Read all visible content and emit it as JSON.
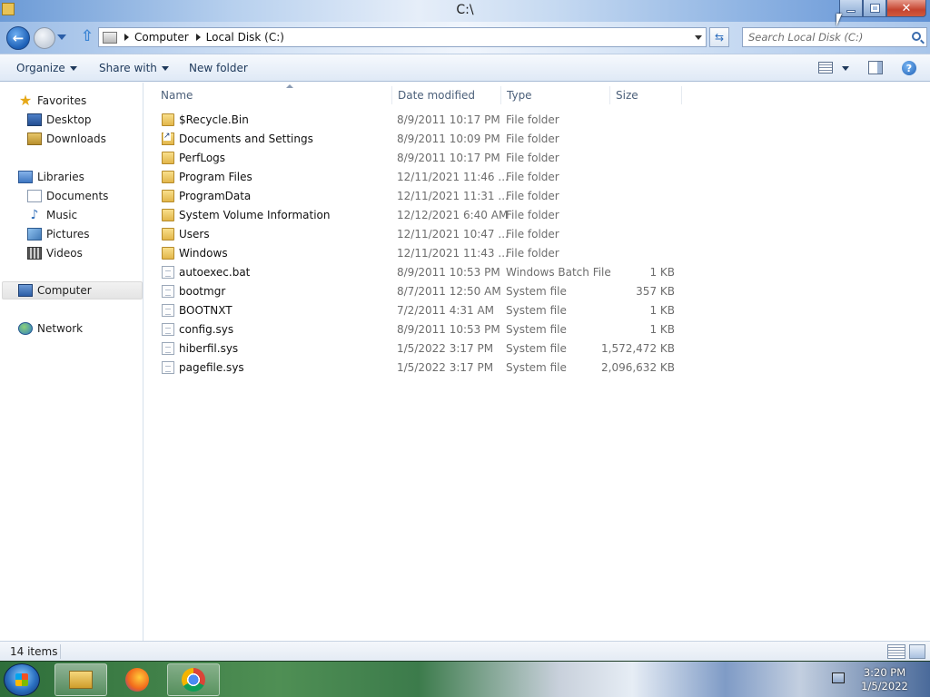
{
  "window": {
    "title": "C:\\",
    "min_label": "",
    "max_label": "",
    "close_label": "✕"
  },
  "address": {
    "crumbs": [
      "Computer",
      "Local Disk (C:)"
    ],
    "search_placeholder": "Search Local Disk (C:)"
  },
  "toolbar": {
    "organize": "Organize",
    "share_with": "Share with",
    "new_folder": "New folder",
    "help": "?"
  },
  "nav": {
    "favorites": "Favorites",
    "desktop": "Desktop",
    "downloads": "Downloads",
    "libraries": "Libraries",
    "documents": "Documents",
    "music": "Music",
    "pictures": "Pictures",
    "videos": "Videos",
    "computer": "Computer",
    "network": "Network"
  },
  "columns": {
    "name": "Name",
    "date": "Date modified",
    "type": "Type",
    "size": "Size"
  },
  "files": [
    {
      "icon": "folder-icon",
      "name": "$Recycle.Bin",
      "date": "8/9/2011 10:17 PM",
      "type": "File folder",
      "size": ""
    },
    {
      "icon": "shortcut-folder-icon",
      "name": "Documents and Settings",
      "date": "8/9/2011 10:09 PM",
      "type": "File folder",
      "size": ""
    },
    {
      "icon": "folder-icon",
      "name": "PerfLogs",
      "date": "8/9/2011 10:17 PM",
      "type": "File folder",
      "size": ""
    },
    {
      "icon": "folder-icon",
      "name": "Program Files",
      "date": "12/11/2021 11:46 ...",
      "type": "File folder",
      "size": ""
    },
    {
      "icon": "folder-icon",
      "name": "ProgramData",
      "date": "12/11/2021 11:31 ...",
      "type": "File folder",
      "size": ""
    },
    {
      "icon": "folder-icon",
      "name": "System Volume Information",
      "date": "12/12/2021 6:40 AM",
      "type": "File folder",
      "size": ""
    },
    {
      "icon": "folder-icon",
      "name": "Users",
      "date": "12/11/2021 10:47 ...",
      "type": "File folder",
      "size": ""
    },
    {
      "icon": "folder-icon",
      "name": "Windows",
      "date": "12/11/2021 11:43 ...",
      "type": "File folder",
      "size": ""
    },
    {
      "icon": "file-icon",
      "name": "autoexec.bat",
      "date": "8/9/2011 10:53 PM",
      "type": "Windows Batch File",
      "size": "1 KB"
    },
    {
      "icon": "file-icon",
      "name": "bootmgr",
      "date": "8/7/2011 12:50 AM",
      "type": "System file",
      "size": "357 KB"
    },
    {
      "icon": "file-icon",
      "name": "BOOTNXT",
      "date": "7/2/2011 4:31 AM",
      "type": "System file",
      "size": "1 KB"
    },
    {
      "icon": "file-icon",
      "name": "config.sys",
      "date": "8/9/2011 10:53 PM",
      "type": "System file",
      "size": "1 KB"
    },
    {
      "icon": "file-icon",
      "name": "hiberfil.sys",
      "date": "1/5/2022 3:17 PM",
      "type": "System file",
      "size": "1,572,472 KB"
    },
    {
      "icon": "file-icon",
      "name": "pagefile.sys",
      "date": "1/5/2022 3:17 PM",
      "type": "System file",
      "size": "2,096,632 KB"
    }
  ],
  "status": {
    "count": "14 items"
  },
  "taskbar": {
    "time": "3:20 PM",
    "date": "1/5/2022",
    "apps": [
      "windows-explorer-icon",
      "firefox-icon",
      "chrome-icon"
    ]
  }
}
